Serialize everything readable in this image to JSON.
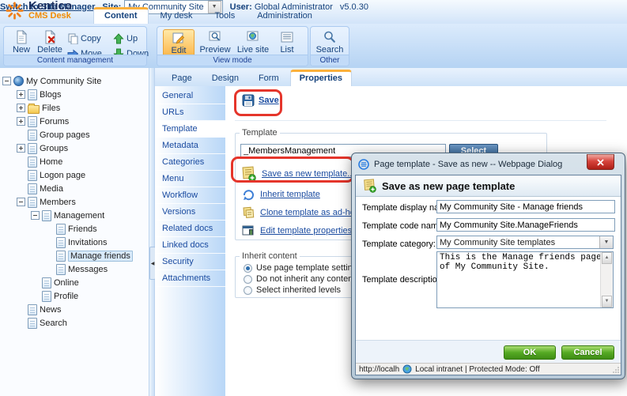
{
  "header": {
    "logo_title": "Kentico",
    "logo_subtitle": "CMS Desk",
    "switch_link": "Switch to Site Manager",
    "site_label": "Site:",
    "site_value": "My Community Site",
    "user_label": "User:",
    "user_value": "Global Administrator",
    "version": "v5.0.30",
    "tabs": [
      {
        "label": "Content",
        "active": true
      },
      {
        "label": "My desk",
        "active": false
      },
      {
        "label": "Tools",
        "active": false
      },
      {
        "label": "Administration",
        "active": false
      }
    ]
  },
  "toolbar": {
    "groups": {
      "content_management": "Content management",
      "view_mode": "View mode",
      "other": "Other"
    },
    "buttons": {
      "new": "New",
      "delete": "Delete",
      "copy": "Copy",
      "move": "Move",
      "up": "Up",
      "down": "Down",
      "edit": "Edit",
      "preview": "Preview",
      "live_site": "Live site",
      "list": "List",
      "search": "Search"
    }
  },
  "tree": {
    "items": [
      {
        "label": "My Community Site"
      },
      {
        "label": "Blogs"
      },
      {
        "label": "Files"
      },
      {
        "label": "Forums"
      },
      {
        "label": "Group pages"
      },
      {
        "label": "Groups"
      },
      {
        "label": "Home"
      },
      {
        "label": "Logon page"
      },
      {
        "label": "Media"
      },
      {
        "label": "Members"
      },
      {
        "label": "Management"
      },
      {
        "label": "Friends"
      },
      {
        "label": "Invitations"
      },
      {
        "label": "Manage friends",
        "selected": true
      },
      {
        "label": "Messages"
      },
      {
        "label": "Online"
      },
      {
        "label": "Profile"
      },
      {
        "label": "News"
      },
      {
        "label": "Search"
      }
    ]
  },
  "content_tabs": [
    "Page",
    "Design",
    "Form",
    "Properties"
  ],
  "properties_menu": [
    "General",
    "URLs",
    "Template",
    "Metadata",
    "Categories",
    "Menu",
    "Workflow",
    "Versions",
    "Related docs",
    "Linked docs",
    "Security",
    "Attachments"
  ],
  "template_section": {
    "save_label": "Save",
    "legend": "Template",
    "template_name_value": "_MembersManagement",
    "select_button": "Select",
    "links": {
      "save_as_new": "Save as new template...",
      "inherit": "Inherit template",
      "clone": "Clone template as ad-hoc",
      "edit_props": "Edit template properties"
    }
  },
  "inherit_section": {
    "legend": "Inherit content",
    "options": [
      {
        "label": "Use page template settings",
        "selected": true
      },
      {
        "label": "Do not inherit any content",
        "selected": false
      },
      {
        "label": "Select inherited levels",
        "selected": false
      }
    ]
  },
  "dialog": {
    "title": "Page template - Save as new -- Webpage Dialog",
    "heading": "Save as new page template",
    "fields": {
      "display_name_label": "Template display name:",
      "display_name_value": "My Community Site - Manage friends",
      "code_name_label": "Template code name:",
      "code_name_value": "My Community Site.ManageFriends",
      "category_label": "Template category:",
      "category_value": "My Community Site templates",
      "description_label": "Template description:",
      "description_value": "This is the Manage friends page\nof My Community Site."
    },
    "ok_button": "OK",
    "cancel_button": "Cancel",
    "statusbar": {
      "url": "http://localh",
      "zone": "Local intranet | Protected Mode: Off"
    }
  }
}
